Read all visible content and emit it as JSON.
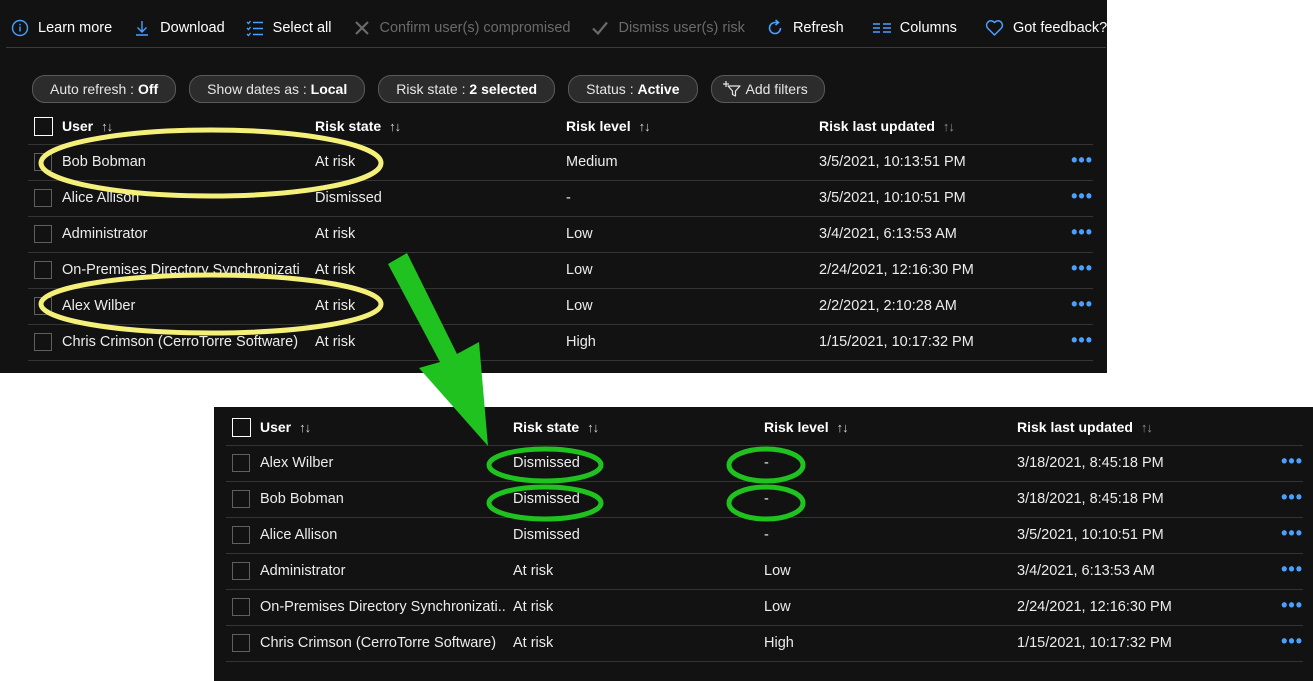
{
  "toolbar": {
    "learn_more": "Learn more",
    "download": "Download",
    "select_all": "Select all",
    "confirm_compromised": "Confirm user(s) compromised",
    "dismiss_risk": "Dismiss user(s) risk",
    "refresh": "Refresh",
    "columns": "Columns",
    "feedback": "Got feedback?"
  },
  "filters": {
    "auto_refresh": {
      "label": "Auto refresh : ",
      "value": "Off"
    },
    "show_dates": {
      "label": "Show dates as : ",
      "value": "Local"
    },
    "risk_state": {
      "label": "Risk state : ",
      "value": "2 selected"
    },
    "status": {
      "label": "Status : ",
      "value": "Active"
    },
    "add_filters": "Add filters"
  },
  "columns": {
    "user": "User",
    "risk_state": "Risk state",
    "risk_level": "Risk level",
    "risk_last_updated": "Risk last updated",
    "sort_glyph": "↑↓"
  },
  "more_glyph": "•••",
  "before_rows": [
    {
      "user": "Bob Bobman",
      "risk_state": "At risk",
      "risk_level": "Medium",
      "updated": "3/5/2021, 10:13:51 PM"
    },
    {
      "user": "Alice Allison",
      "risk_state": "Dismissed",
      "risk_level": "-",
      "updated": "3/5/2021, 10:10:51 PM"
    },
    {
      "user": "Administrator",
      "risk_state": "At risk",
      "risk_level": "Low",
      "updated": "3/4/2021, 6:13:53 AM"
    },
    {
      "user": "On-Premises Directory Synchronizati",
      "risk_state": "At risk",
      "risk_level": "Low",
      "updated": "2/24/2021, 12:16:30 PM"
    },
    {
      "user": "Alex Wilber",
      "risk_state": "At risk",
      "risk_level": "Low",
      "updated": "2/2/2021, 2:10:28 AM"
    },
    {
      "user": "Chris Crimson (CerroTorre Software)",
      "risk_state": "At risk",
      "risk_level": "High",
      "updated": "1/15/2021, 10:17:32 PM"
    }
  ],
  "after_rows": [
    {
      "user": "Alex Wilber",
      "risk_state": "Dismissed",
      "risk_level": "-",
      "updated": "3/18/2021, 8:45:18 PM"
    },
    {
      "user": "Bob Bobman",
      "risk_state": "Dismissed",
      "risk_level": "-",
      "updated": "3/18/2021, 8:45:18 PM"
    },
    {
      "user": "Alice Allison",
      "risk_state": "Dismissed",
      "risk_level": "-",
      "updated": "3/5/2021, 10:10:51 PM"
    },
    {
      "user": "Administrator",
      "risk_state": "At risk",
      "risk_level": "Low",
      "updated": "3/4/2021, 6:13:53 AM"
    },
    {
      "user": "On-Premises Directory Synchronizati...",
      "risk_state": "At risk",
      "risk_level": "Low",
      "updated": "2/24/2021, 12:16:30 PM"
    },
    {
      "user": "Chris Crimson (CerroTorre Software)",
      "risk_state": "At risk",
      "risk_level": "High",
      "updated": "1/15/2021, 10:17:32 PM"
    }
  ],
  "colors": {
    "panel_bg": "#121212",
    "accent_blue": "#4aa0ff",
    "highlight_yellow": "#f5f07a",
    "highlight_green": "#1fc21f"
  }
}
